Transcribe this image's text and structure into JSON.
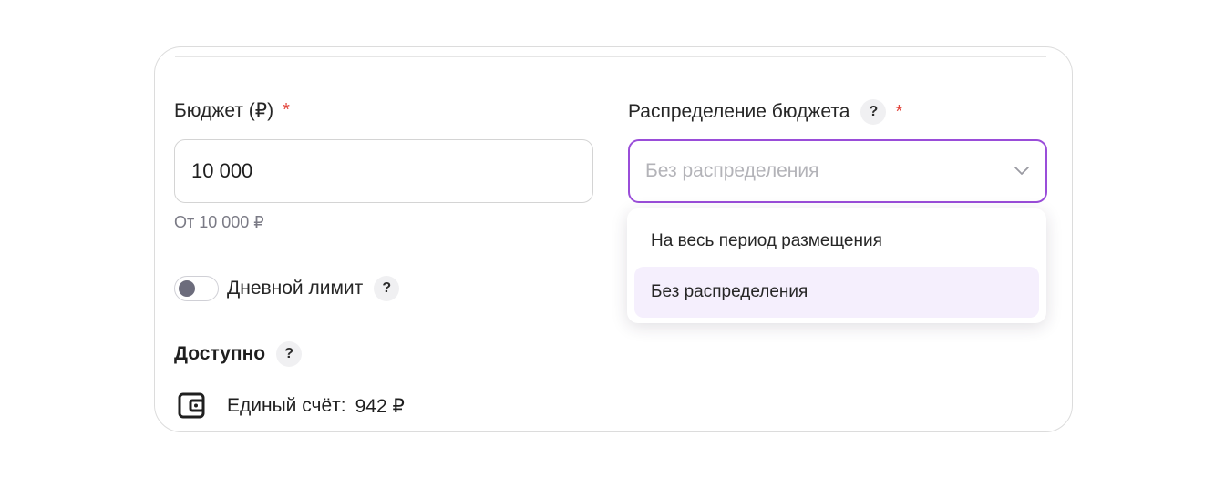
{
  "budget": {
    "label": "Бюджет (₽)",
    "required_mark": "*",
    "value": "10 000",
    "hint": "От 10 000 ₽"
  },
  "daily_limit": {
    "label": "Дневной лимит",
    "help": "?",
    "enabled": false
  },
  "available": {
    "title": "Доступно",
    "help": "?",
    "account_label": "Единый счёт:",
    "account_value": "942 ₽",
    "icon": "wallet-icon"
  },
  "distribution": {
    "label": "Распределение бюджета",
    "help": "?",
    "required_mark": "*",
    "placeholder": "Без распределения",
    "options": [
      {
        "label": "На весь период размещения"
      },
      {
        "label": "Без распределения"
      }
    ]
  },
  "colors": {
    "accent": "#9a4dd9",
    "required": "#e2453c",
    "option_highlight": "#f5effd"
  }
}
